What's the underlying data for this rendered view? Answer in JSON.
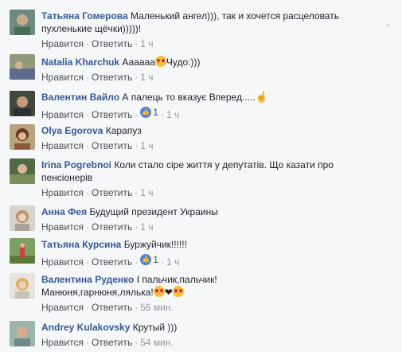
{
  "comments": [
    {
      "name": "Татьяна Гомерова",
      "text": "Маленький ангел))), так и хочется расцеловать пухленькие щёчки)))))!",
      "like": "Нравится",
      "reply": "Ответить",
      "time": "1 ч",
      "sep": "·"
    },
    {
      "name": "Natalia Kharchuk",
      "text_before": "Аааааа",
      "text_after": "Чудо:)))",
      "like": "Нравится",
      "reply": "Ответить",
      "time": "1 ч",
      "sep": "·"
    },
    {
      "name": "Валентин Вайло",
      "text": "А палець то вказує Вперед.....",
      "like": "Нравится",
      "reply": "Ответить",
      "likes_count": "1",
      "time": "1 ч",
      "sep": "·"
    },
    {
      "name": "Olya Egorova",
      "text": "Карапуз",
      "like": "Нравится",
      "reply": "Ответить",
      "time": "1 ч",
      "sep": "·"
    },
    {
      "name": "Irina Pogrebnoi",
      "text": "Коли стало сіре життя у депутатів. Що казати про пенсіонерів",
      "like": "Нравится",
      "reply": "Ответить",
      "time": "1 ч",
      "sep": "·"
    },
    {
      "name": "Анна Фея",
      "text": "Будущий президент Украины",
      "like": "Нравится",
      "reply": "Ответить",
      "time": "1 ч",
      "sep": "·"
    },
    {
      "name": "Татьяна Курсина",
      "text": "Буржуйчик!!!!!!",
      "like": "Нравится",
      "reply": "Ответить",
      "likes_count": "1",
      "time": "1 ч",
      "sep": "·"
    },
    {
      "name": "Валентина Руденко",
      "text_line1": "І пальчик,пальчик!",
      "text_line2": "Манюня,гарнюня,лялька!",
      "like": "Нравится",
      "reply": "Ответить",
      "time": "56 мин.",
      "sep": "·"
    },
    {
      "name": "Andrey Kulakovsky",
      "text": "Крутый )))",
      "like": "Нравится",
      "reply": "Ответить",
      "time": "54 мин.",
      "sep": "·"
    }
  ],
  "colors": {
    "name": "#365899",
    "action": "#4b4f56",
    "meta": "#90949c",
    "background": "#f6f7f9",
    "like_badge": "#4f82e3"
  },
  "icons": {
    "menu": "chevron-down-icon",
    "like": "thumbs-up-icon",
    "emoji": "heart-eyes-emoji-icon",
    "pointer": "pointing-hand-icon"
  }
}
